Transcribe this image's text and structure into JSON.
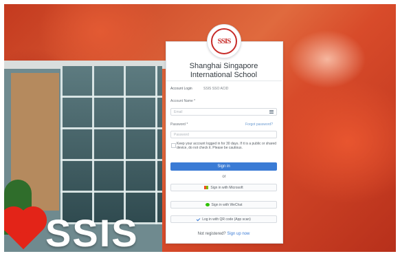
{
  "school": {
    "name": "Shanghai Singapore International School",
    "logo_text": "SSIS"
  },
  "background": {
    "sign_text": "SSIS"
  },
  "login": {
    "account_label": "Account Login",
    "account_value": "SSIS SSO ACID",
    "username_label": "Account Name *",
    "username_placeholder": "Email",
    "password_label": "Password *",
    "forgot_label": "Forgot password?",
    "password_placeholder": "Password",
    "remember_text": "Keep your account logged in for 30 days. If it is a public or shared device, do not check it. Please be cautious.",
    "signin_label": "Sign in",
    "or_text": "or",
    "alt_buttons": [
      {
        "label": "Sign in with Microsoft"
      },
      {
        "label": "Sign in with WeChat"
      },
      {
        "label": "Log in with QR code (App scan)"
      }
    ],
    "footer_text": "Not registered?",
    "footer_link": "Sign up now"
  },
  "colors": {
    "primary": "#3a7bd5",
    "brand_red": "#c72b28"
  }
}
